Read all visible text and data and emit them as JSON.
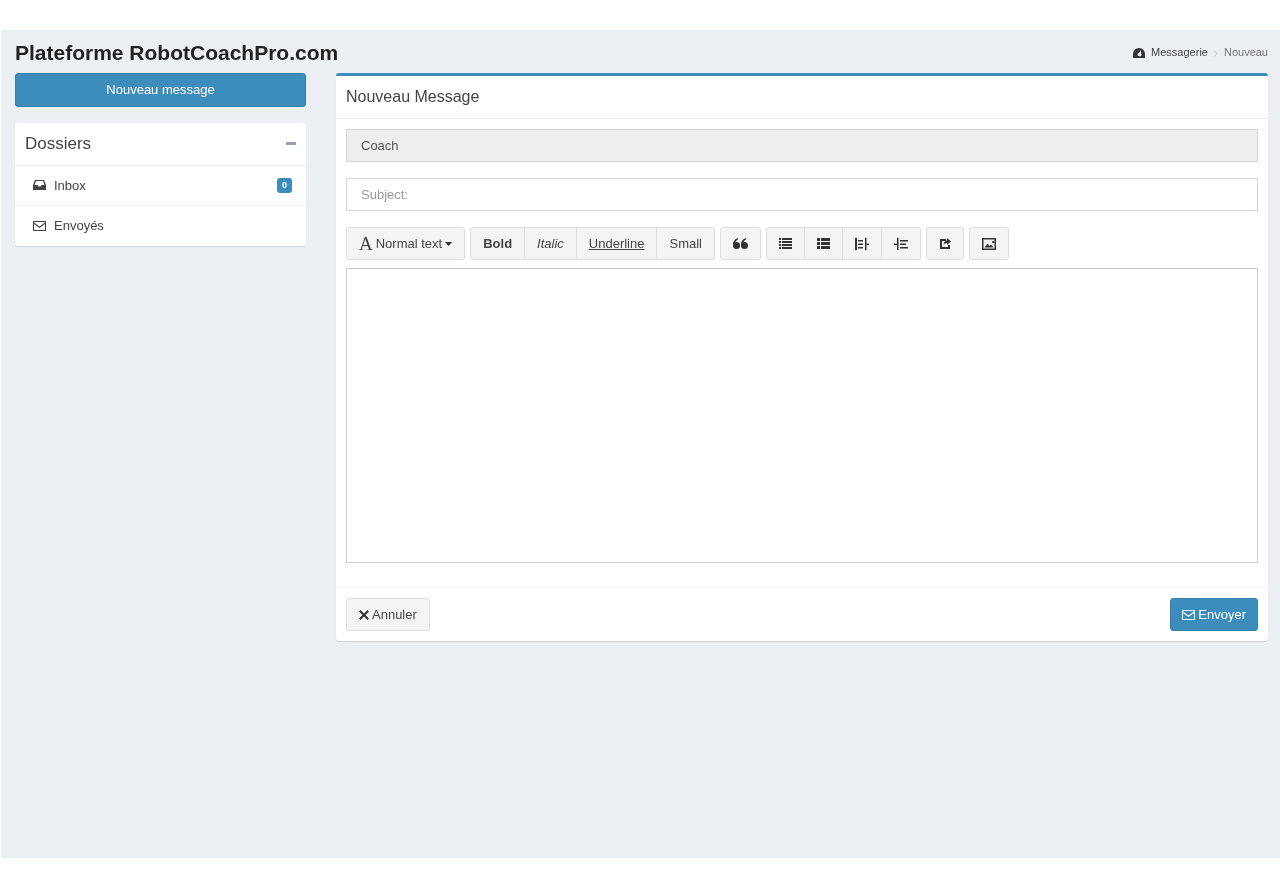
{
  "title": "Plateforme RobotCoachPro.com",
  "breadcrumb": [
    {
      "label": "Messagerie",
      "kind": "root"
    },
    {
      "label": "Nouveau",
      "kind": "current"
    }
  ],
  "new_message_button": "Nouveau message",
  "folders": {
    "title": "Dossiers",
    "items": [
      {
        "label": "Inbox",
        "kind": "inbox",
        "badge": "0"
      },
      {
        "label": "Envoyés",
        "kind": "sent"
      }
    ]
  },
  "compose": {
    "title": "Nouveau Message",
    "to": {
      "value": "Coach",
      "disabled": true
    },
    "subject": {
      "placeholder": "Subject:"
    },
    "toolbar": [
      [
        {
          "kind": "dropdown",
          "glyph": "A",
          "label": "Normal text"
        }
      ],
      [
        {
          "kind": "bold",
          "label": "Bold"
        },
        {
          "kind": "italic",
          "label": "Italic"
        },
        {
          "kind": "underline",
          "label": "Underline"
        },
        {
          "kind": "small",
          "label": "Small"
        }
      ],
      [
        {
          "kind": "quote"
        }
      ],
      [
        {
          "kind": "list-ul"
        },
        {
          "kind": "list-ol"
        },
        {
          "kind": "outdent"
        },
        {
          "kind": "indent"
        }
      ],
      [
        {
          "kind": "share"
        }
      ],
      [
        {
          "kind": "image"
        }
      ]
    ],
    "cancel": "Annuler",
    "send": "Envoyer"
  }
}
